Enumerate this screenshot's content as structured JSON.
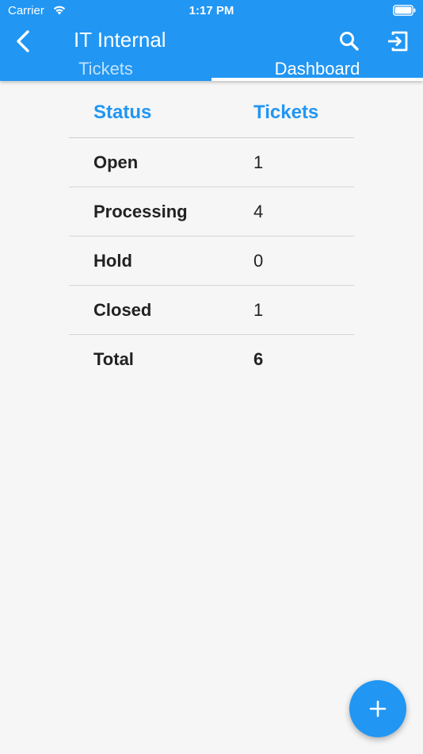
{
  "status_bar": {
    "carrier": "Carrier",
    "time": "1:17 PM"
  },
  "header": {
    "title": "IT Internal",
    "tabs": [
      {
        "label": "Tickets",
        "selected": false
      },
      {
        "label": "Dashboard",
        "selected": true
      }
    ]
  },
  "table": {
    "columns": [
      "Status",
      "Tickets"
    ],
    "rows": [
      {
        "status": "Open",
        "tickets": "1"
      },
      {
        "status": "Processing",
        "tickets": "4"
      },
      {
        "status": "Hold",
        "tickets": "0"
      },
      {
        "status": "Closed",
        "tickets": "1"
      },
      {
        "status": "Total",
        "tickets": "6"
      }
    ]
  },
  "colors": {
    "primary": "#2196f3",
    "background": "#f6f6f6",
    "text": "#222222"
  },
  "icons": {
    "back": "chevron-left-icon",
    "search": "search-icon",
    "logout": "exit-icon",
    "fab": "plus-icon"
  }
}
